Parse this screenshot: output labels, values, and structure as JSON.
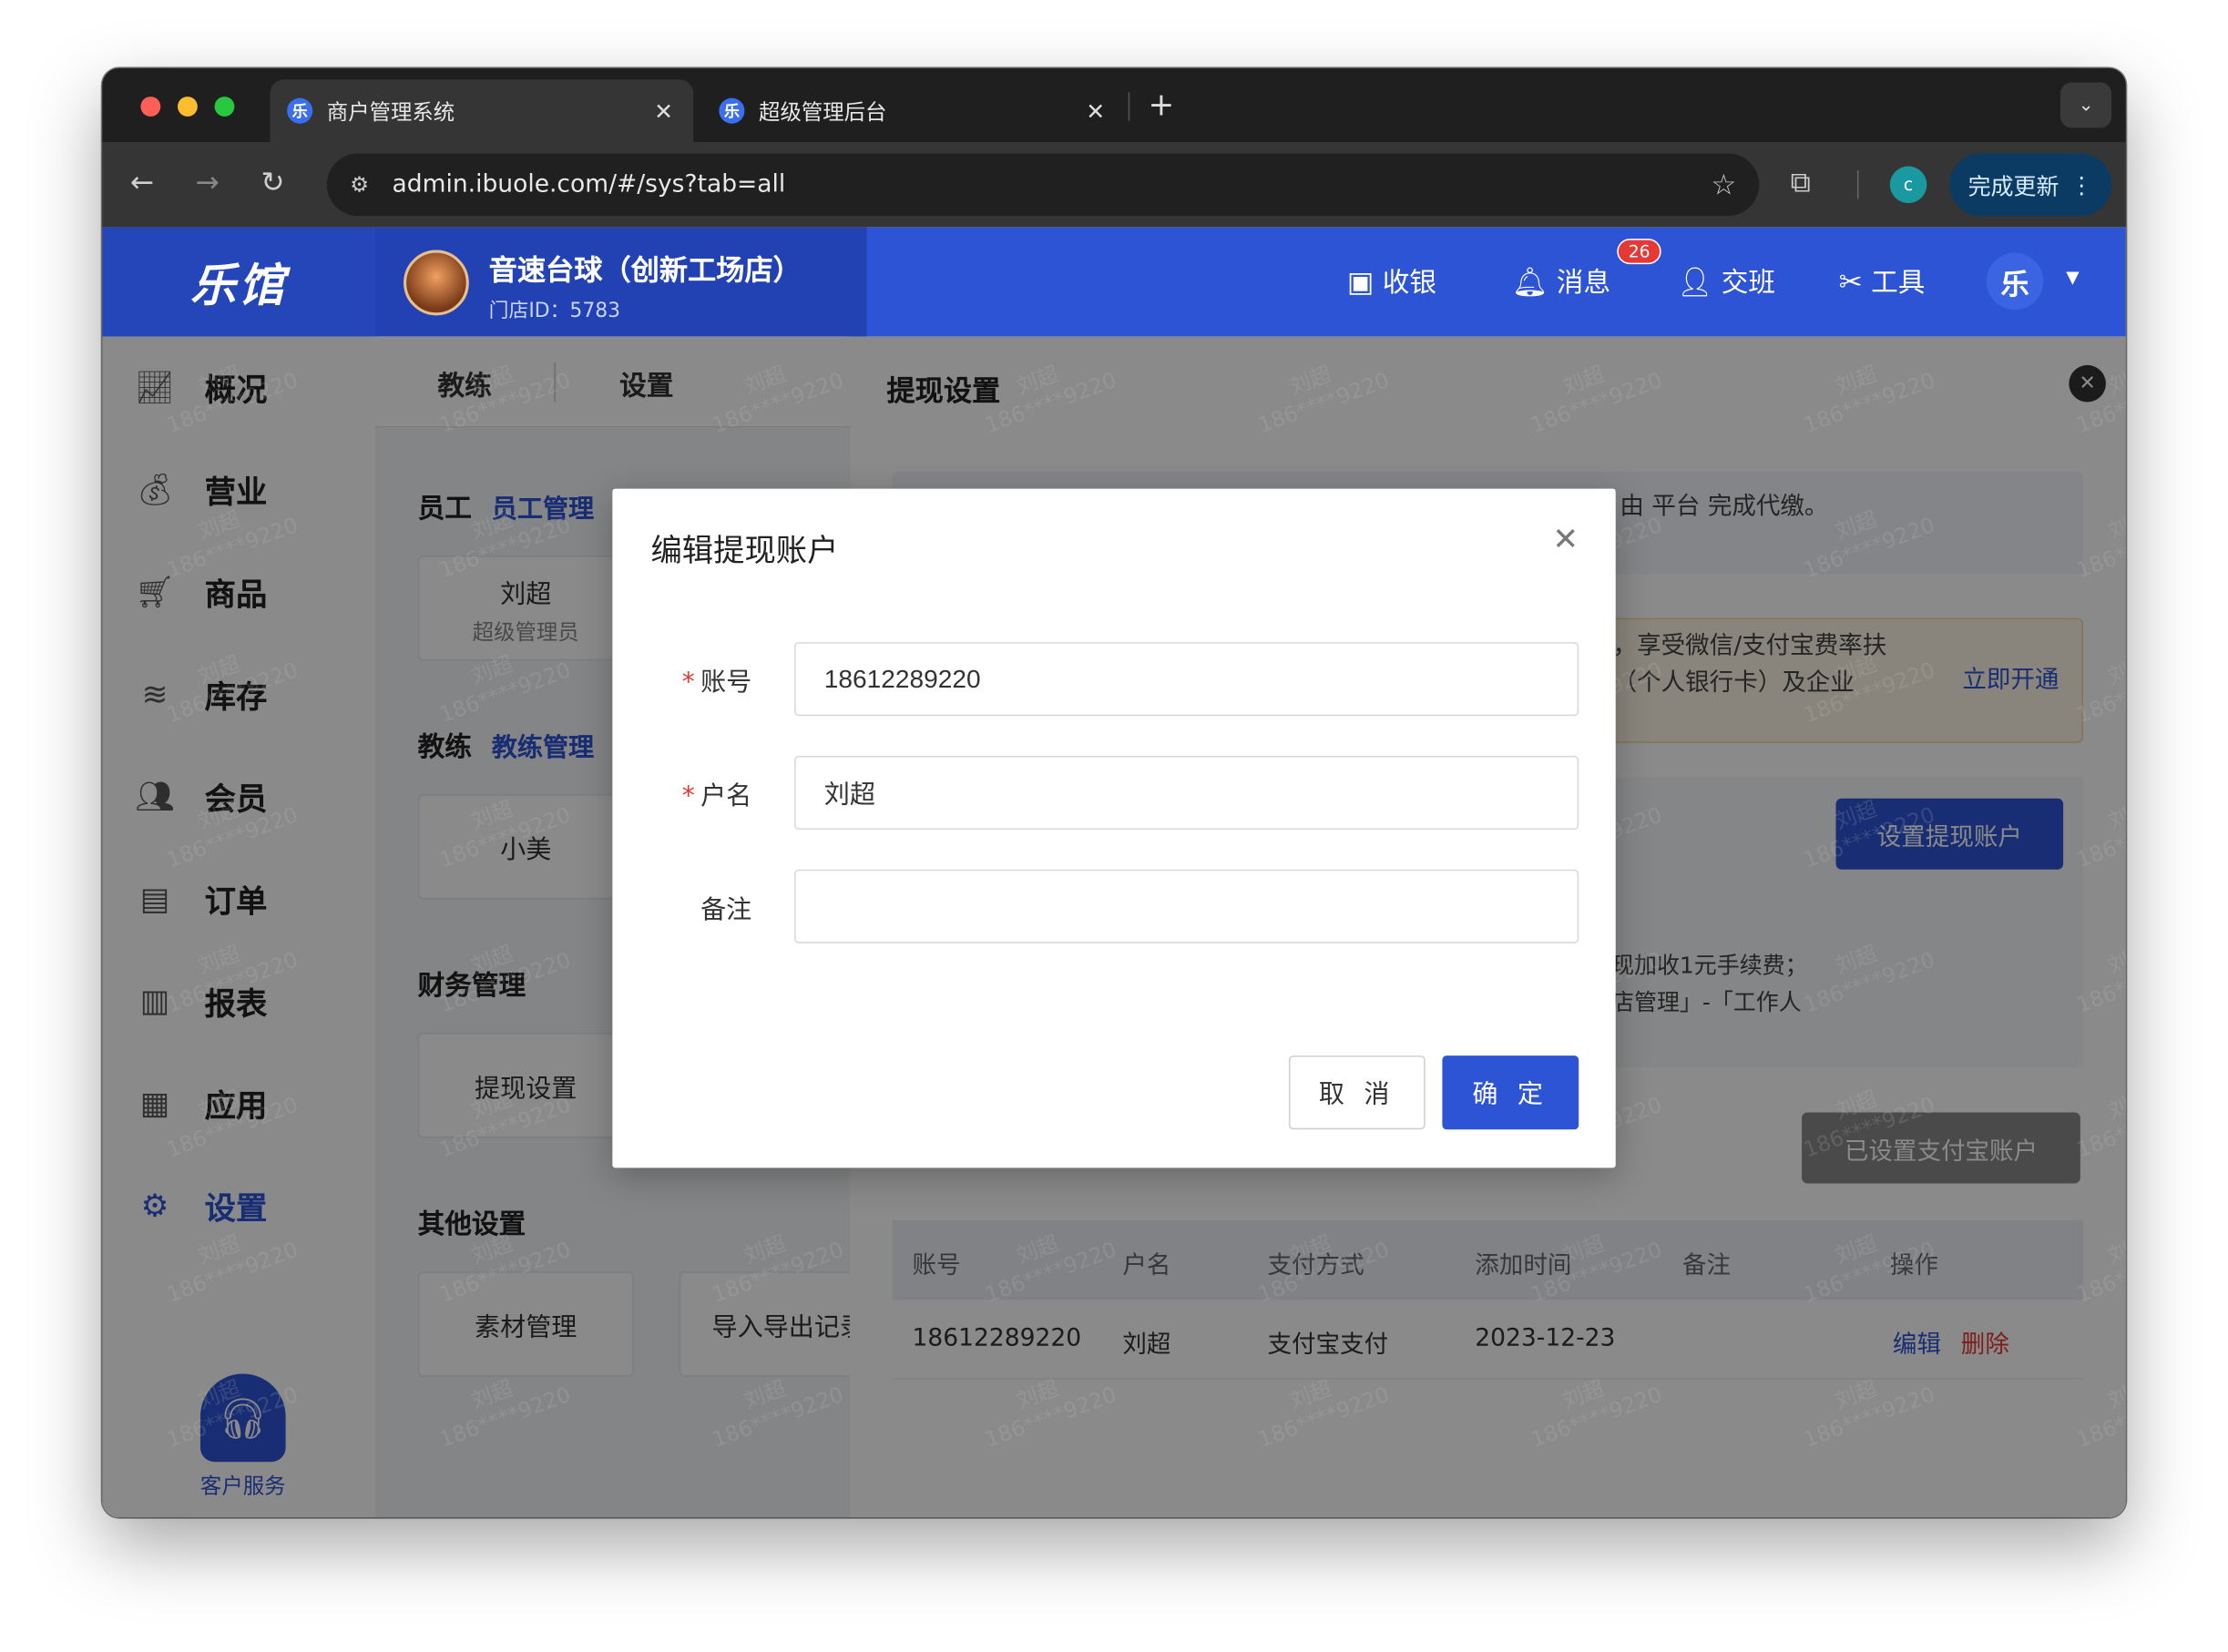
{
  "browser": {
    "tabs": [
      {
        "title": "商户管理系统",
        "favicon": "乐",
        "active": true
      },
      {
        "title": "超级管理后台",
        "favicon": "乐",
        "active": false
      }
    ],
    "url": "admin.ibuole.com/#/sys?tab=all",
    "profile_initial": "c",
    "update_label": "完成更新"
  },
  "app": {
    "logo": "乐馆",
    "store_name": "音速台球（创新工场店）",
    "store_id": "门店ID：5783",
    "header": {
      "cashier": "收银",
      "messages": "消息",
      "message_count": "26",
      "handover": "交班",
      "tools": "工具",
      "user_initial": "乐"
    },
    "sidebar": {
      "items": [
        {
          "label": "概况",
          "icon": "chart-line-icon"
        },
        {
          "label": "营业",
          "icon": "money-bag-icon"
        },
        {
          "label": "商品",
          "icon": "cart-icon"
        },
        {
          "label": "库存",
          "icon": "layers-icon"
        },
        {
          "label": "会员",
          "icon": "users-icon"
        },
        {
          "label": "订单",
          "icon": "receipt-icon"
        },
        {
          "label": "报表",
          "icon": "bar-chart-icon"
        },
        {
          "label": "应用",
          "icon": "apps-icon"
        },
        {
          "label": "设置",
          "icon": "gear-icon",
          "active": true
        }
      ],
      "service_label": "客户服务"
    },
    "mid": {
      "tabs": [
        "教练",
        "设置"
      ],
      "staff_title": "员工",
      "staff_link": "员工管理",
      "staff_card": {
        "name": "刘超",
        "role": "超级管理员"
      },
      "coach_title": "教练",
      "coach_link": "教练管理",
      "coach_card": {
        "name": "小美"
      },
      "finance_title": "财务管理",
      "finance_card": "提现设置",
      "other_title": "其他设置",
      "other_cards": [
        "素材管理",
        "导入导出记录"
      ]
    },
    "panel": {
      "title": "提现设置",
      "info_text": "由 平台 完成代缴。",
      "warn_line1": "，享受微信/支付宝费率扶",
      "warn_line2": "（个人银行卡）及企业",
      "warn_link": "立即开通",
      "set_account_button": "设置提现账户",
      "note_line1": "现加收1元手续费；",
      "note_line2": "店管理」-「工作人",
      "alipay_button": "已设置支付宝账户",
      "table": {
        "headers": [
          "账号",
          "户名",
          "支付方式",
          "添加时间",
          "备注",
          "操作"
        ],
        "rows": [
          {
            "account": "18612289220",
            "name": "刘超",
            "method": "支付宝支付",
            "date": "2023-12-23",
            "remark": "",
            "edit": "编辑",
            "delete": "删除"
          }
        ]
      }
    }
  },
  "watermark": {
    "line1": "刘超",
    "line2": "186****9220"
  },
  "modal": {
    "title": "编辑提现账户",
    "account_label": "账号",
    "account_value": "18612289220",
    "name_label": "户名",
    "name_value": "刘超",
    "remark_label": "备注",
    "remark_value": "",
    "cancel_label": "取 消",
    "ok_label": "确 定"
  },
  "colors": {
    "primary": "#2d54d4",
    "danger": "#e53935",
    "header_bg": "#2d54d4"
  }
}
